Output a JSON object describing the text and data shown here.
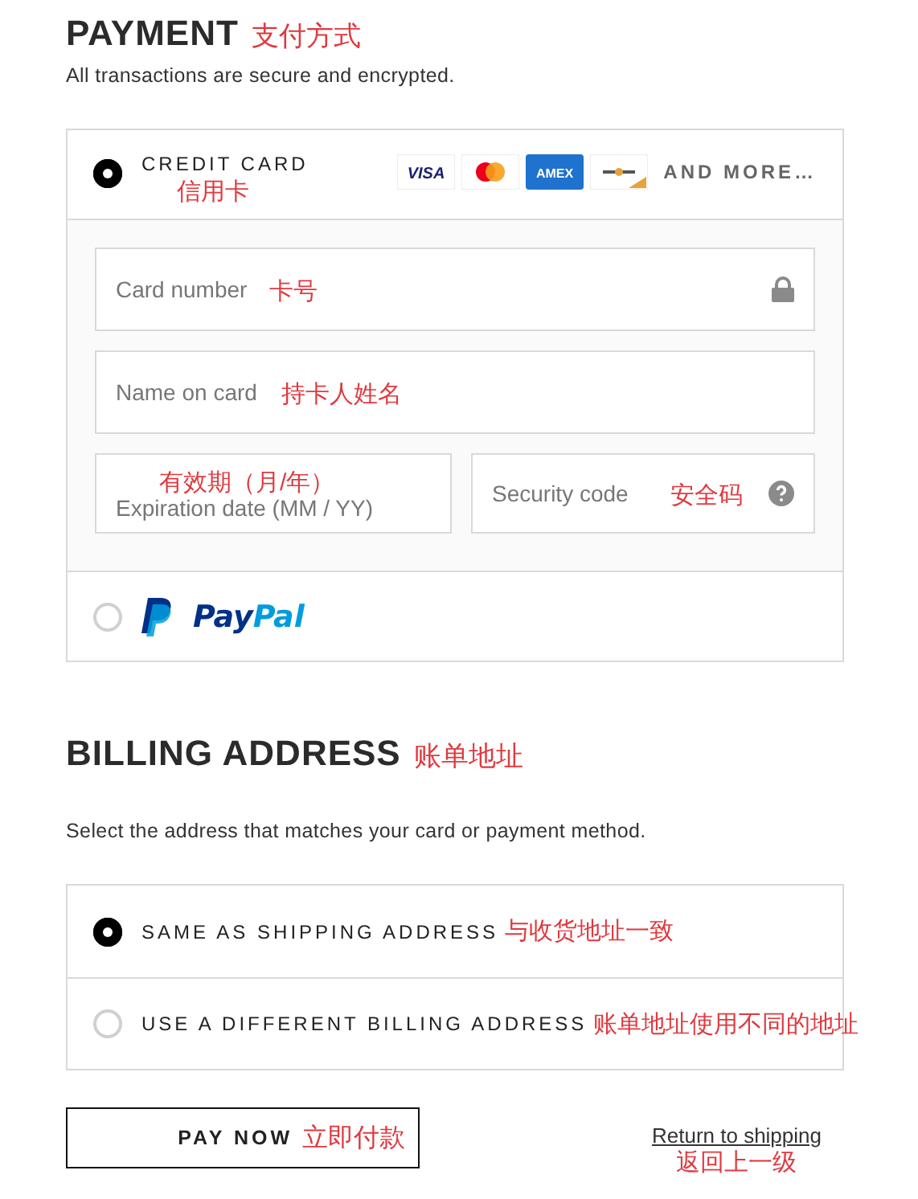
{
  "payment": {
    "title": "PAYMENT",
    "title_note": "支付方式",
    "subtitle": "All transactions are secure and encrypted.",
    "methods": [
      {
        "kind": "card",
        "selected": true,
        "label": "CREDIT CARD",
        "note": "信用卡",
        "more": "AND MORE…",
        "brands": [
          {
            "kind": "visa",
            "label": "VISA"
          },
          {
            "kind": "mastercard"
          },
          {
            "kind": "amex",
            "label": "AMEX"
          },
          {
            "kind": "generic"
          }
        ],
        "fields": [
          {
            "kind": "locked",
            "placeholder": "Card number",
            "note": "卡号",
            "note_above": false
          },
          {
            "kind": "plain",
            "placeholder": "Name on card",
            "note": "持卡人姓名",
            "note_above": false
          },
          {
            "kind": "plain",
            "placeholder": "Expiration date (MM / YY)",
            "note": "有效期（月/年）",
            "note_above": true
          },
          {
            "kind": "hint",
            "placeholder": "Security code",
            "note": "安全码",
            "note_above": false
          }
        ]
      },
      {
        "kind": "paypal",
        "selected": false,
        "label_parts": [
          "Pay",
          "Pal"
        ]
      }
    ]
  },
  "billing": {
    "title": "BILLING ADDRESS",
    "title_note": "账单地址",
    "subtitle": "Select the address that matches your card or payment method.",
    "options": [
      {
        "label": "SAME AS SHIPPING ADDRESS",
        "note": "与收货地址一致",
        "selected": true
      },
      {
        "label": "USE A DIFFERENT BILLING ADDRESS",
        "note": "账单地址使用不同的地址",
        "selected": false
      }
    ]
  },
  "actions": {
    "pay": {
      "label": "PAY NOW",
      "note": "立即付款"
    },
    "back": {
      "label": "Return to shipping",
      "note": "返回上一级"
    }
  }
}
